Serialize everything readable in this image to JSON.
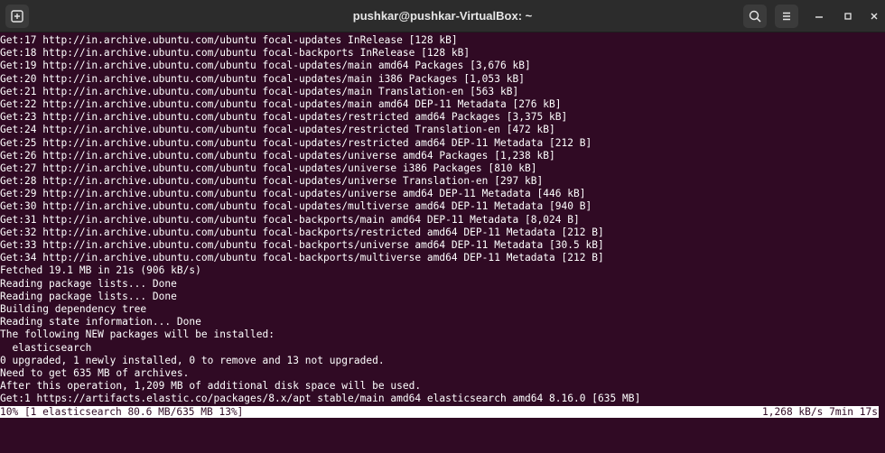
{
  "window": {
    "title": "pushkar@pushkar-VirtualBox: ~",
    "new_tab_icon": "new-tab-icon",
    "search_icon": "search-icon",
    "menu_icon": "hamburger-menu-icon"
  },
  "terminal": {
    "lines": [
      "Get:17 http://in.archive.ubuntu.com/ubuntu focal-updates InRelease [128 kB]",
      "Get:18 http://in.archive.ubuntu.com/ubuntu focal-backports InRelease [128 kB]",
      "Get:19 http://in.archive.ubuntu.com/ubuntu focal-updates/main amd64 Packages [3,676 kB]",
      "Get:20 http://in.archive.ubuntu.com/ubuntu focal-updates/main i386 Packages [1,053 kB]",
      "Get:21 http://in.archive.ubuntu.com/ubuntu focal-updates/main Translation-en [563 kB]",
      "Get:22 http://in.archive.ubuntu.com/ubuntu focal-updates/main amd64 DEP-11 Metadata [276 kB]",
      "Get:23 http://in.archive.ubuntu.com/ubuntu focal-updates/restricted amd64 Packages [3,375 kB]",
      "Get:24 http://in.archive.ubuntu.com/ubuntu focal-updates/restricted Translation-en [472 kB]",
      "Get:25 http://in.archive.ubuntu.com/ubuntu focal-updates/restricted amd64 DEP-11 Metadata [212 B]",
      "Get:26 http://in.archive.ubuntu.com/ubuntu focal-updates/universe amd64 Packages [1,238 kB]",
      "Get:27 http://in.archive.ubuntu.com/ubuntu focal-updates/universe i386 Packages [810 kB]",
      "Get:28 http://in.archive.ubuntu.com/ubuntu focal-updates/universe Translation-en [297 kB]",
      "Get:29 http://in.archive.ubuntu.com/ubuntu focal-updates/universe amd64 DEP-11 Metadata [446 kB]",
      "Get:30 http://in.archive.ubuntu.com/ubuntu focal-updates/multiverse amd64 DEP-11 Metadata [940 B]",
      "Get:31 http://in.archive.ubuntu.com/ubuntu focal-backports/main amd64 DEP-11 Metadata [8,024 B]",
      "Get:32 http://in.archive.ubuntu.com/ubuntu focal-backports/restricted amd64 DEP-11 Metadata [212 B]",
      "Get:33 http://in.archive.ubuntu.com/ubuntu focal-backports/universe amd64 DEP-11 Metadata [30.5 kB]",
      "Get:34 http://in.archive.ubuntu.com/ubuntu focal-backports/multiverse amd64 DEP-11 Metadata [212 B]",
      "Fetched 19.1 MB in 21s (906 kB/s)",
      "Reading package lists... Done",
      "Reading package lists... Done",
      "Building dependency tree",
      "Reading state information... Done",
      "The following NEW packages will be installed:",
      "  elasticsearch",
      "0 upgraded, 1 newly installed, 0 to remove and 13 not upgraded.",
      "Need to get 635 MB of archives.",
      "After this operation, 1,209 MB of additional disk space will be used.",
      "Get:1 https://artifacts.elastic.co/packages/8.x/apt stable/main amd64 elasticsearch amd64 8.16.0 [635 MB]"
    ],
    "status_left": "10% [1 elasticsearch 80.6 MB/635 MB 13%]",
    "status_right": "1,268 kB/s 7min 17s"
  },
  "colors": {
    "terminal_bg": "#300a24",
    "titlebar_bg": "#2c2c2c",
    "text": "#ffffff"
  }
}
